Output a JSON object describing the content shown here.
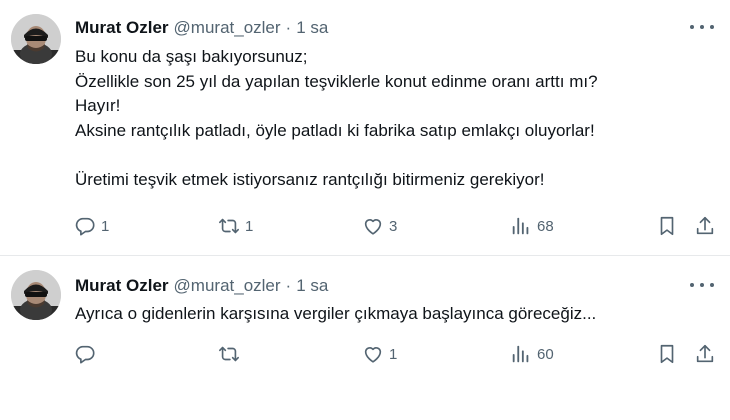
{
  "tweets": [
    {
      "author": {
        "name": "Murat Ozler",
        "handle": "@murat_ozler",
        "separator": "·",
        "time": "1 sa"
      },
      "lines": [
        "Bu konu da şaşı bakıyorsunuz;",
        "Özellikle son 25 yıl da yapılan teşviklerle konut edinme oranı arttı mı?",
        "Hayır!",
        "Aksine rantçılık patladı, öyle patladı ki fabrika satıp emlakçı oluyorlar!",
        "",
        "Üretimi teşvik etmek istiyorsanız rantçılığı bitirmeniz gerekiyor!"
      ],
      "stats": {
        "replies": "1",
        "retweets": "1",
        "likes": "3",
        "views": "68"
      }
    },
    {
      "author": {
        "name": "Murat Ozler",
        "handle": "@murat_ozler",
        "separator": "·",
        "time": "1 sa"
      },
      "lines": [
        "Ayrıca o gidenlerin karşısına vergiler çıkmaya başlayınca göreceğiz..."
      ],
      "stats": {
        "replies": "",
        "retweets": "",
        "likes": "1",
        "views": "60"
      }
    }
  ],
  "icons": {
    "reply": "reply-icon",
    "retweet": "retweet-icon",
    "like": "heart-icon",
    "views": "views-icon",
    "bookmark": "bookmark-icon",
    "share": "share-icon",
    "more": "more-icon"
  },
  "colors": {
    "text": "#0f1419",
    "secondary": "#536471",
    "divider": "#e7e9eb"
  }
}
